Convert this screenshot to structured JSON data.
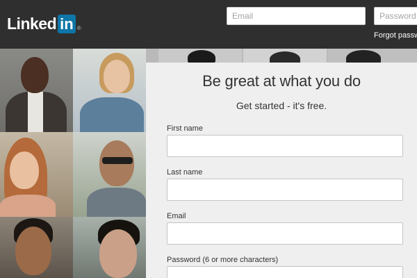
{
  "header": {
    "logo": {
      "text": "Linked",
      "box_text": "in",
      "registered": "®"
    },
    "email_placeholder": "Email",
    "password_placeholder": "Password",
    "forgot_link": "Forgot password?"
  },
  "signup": {
    "title": "Be great at what you do",
    "subtitle": "Get started - it's free.",
    "fields": [
      {
        "label": "First name",
        "value": ""
      },
      {
        "label": "Last name",
        "value": ""
      },
      {
        "label": "Email",
        "value": ""
      },
      {
        "label": "Password (6 or more characters)",
        "value": ""
      }
    ]
  },
  "colors": {
    "header_bg": "#2f2f2f",
    "brand_blue": "#0e76a8",
    "panel_bg": "#efefef",
    "text": "#333333"
  }
}
